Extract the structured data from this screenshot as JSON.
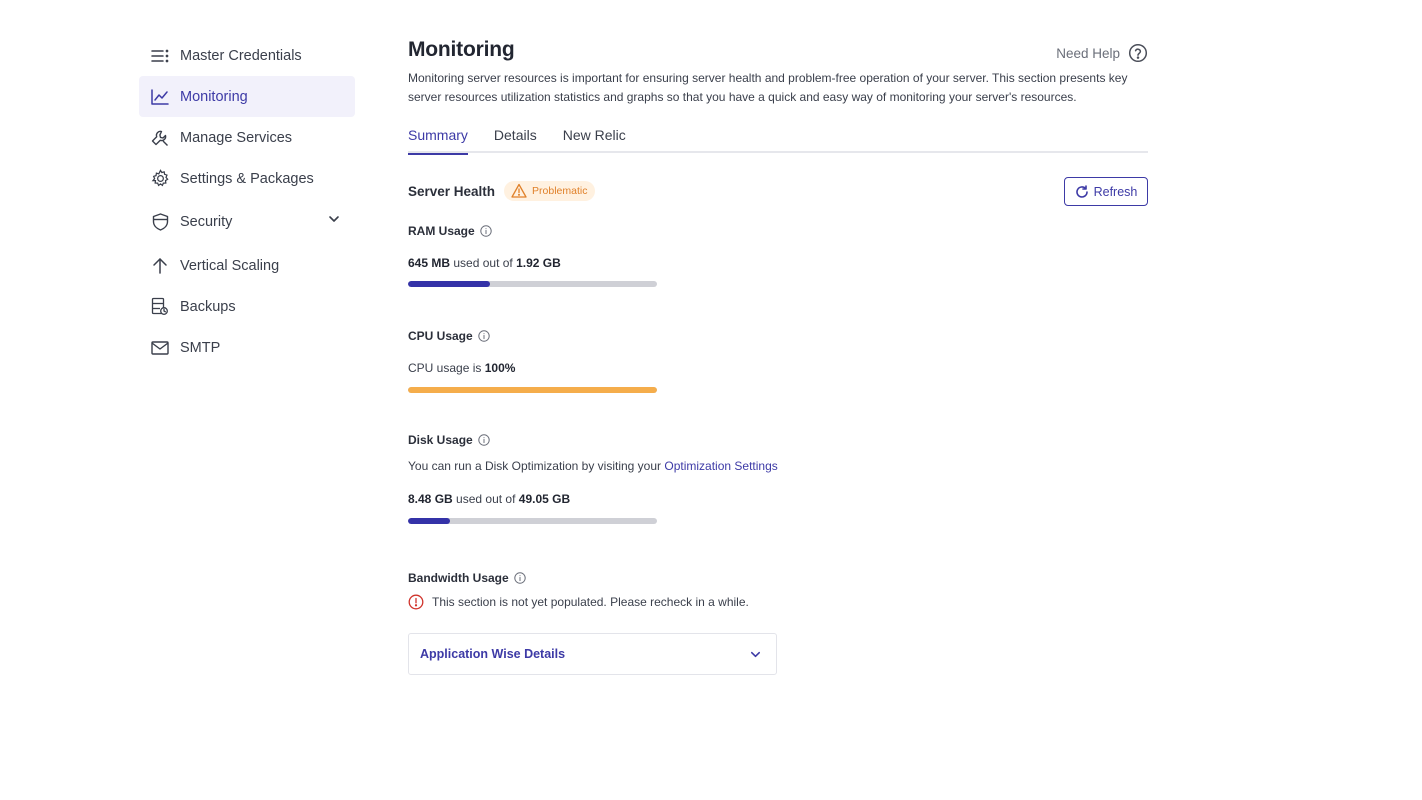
{
  "sidebar": {
    "items": [
      {
        "label": "Master Credentials",
        "icon": "list-icon"
      },
      {
        "label": "Monitoring",
        "icon": "chart-line-icon",
        "active": true
      },
      {
        "label": "Manage Services",
        "icon": "wrench-icon"
      },
      {
        "label": "Settings & Packages",
        "icon": "gear-icon"
      },
      {
        "label": "Security",
        "icon": "shield-icon",
        "expandable": true
      },
      {
        "label": "Vertical Scaling",
        "icon": "arrow-up-icon"
      },
      {
        "label": "Backups",
        "icon": "backup-icon"
      },
      {
        "label": "SMTP",
        "icon": "mail-icon"
      }
    ]
  },
  "header": {
    "title": "Monitoring",
    "need_help": "Need Help",
    "description": "Monitoring server resources is important for ensuring server health and problem-free operation of your server. This section presents key server resources utilization statistics and graphs so that you have a quick and easy way of monitoring your server's resources."
  },
  "tabs": [
    {
      "label": "Summary",
      "active": true
    },
    {
      "label": "Details"
    },
    {
      "label": "New Relic"
    }
  ],
  "server_health": {
    "title": "Server Health",
    "status": "Problematic",
    "refresh_label": "Refresh"
  },
  "ram": {
    "label": "RAM Usage",
    "used": "645 MB",
    "middle": "used out of",
    "total": "1.92 GB",
    "fraction": 0.33,
    "color": "#3432a8"
  },
  "cpu": {
    "label": "CPU Usage",
    "prefix": "CPU usage is",
    "value": "100%",
    "fraction": 1.0,
    "color": "#f5ad4b"
  },
  "disk": {
    "label": "Disk Usage",
    "note": "You can run a Disk Optimization by visiting your",
    "note_link": "Optimization Settings",
    "used": "8.48 GB",
    "middle": "used out of",
    "total": "49.05 GB",
    "fraction": 0.17,
    "color": "#3432a8"
  },
  "bandwidth": {
    "label": "Bandwidth Usage",
    "message": "This section is not yet populated. Please recheck in a while."
  },
  "app_details": {
    "label": "Application Wise Details"
  },
  "colors": {
    "accent": "#3d3aa6",
    "warning": "#e0812a",
    "error": "#d0342c"
  }
}
